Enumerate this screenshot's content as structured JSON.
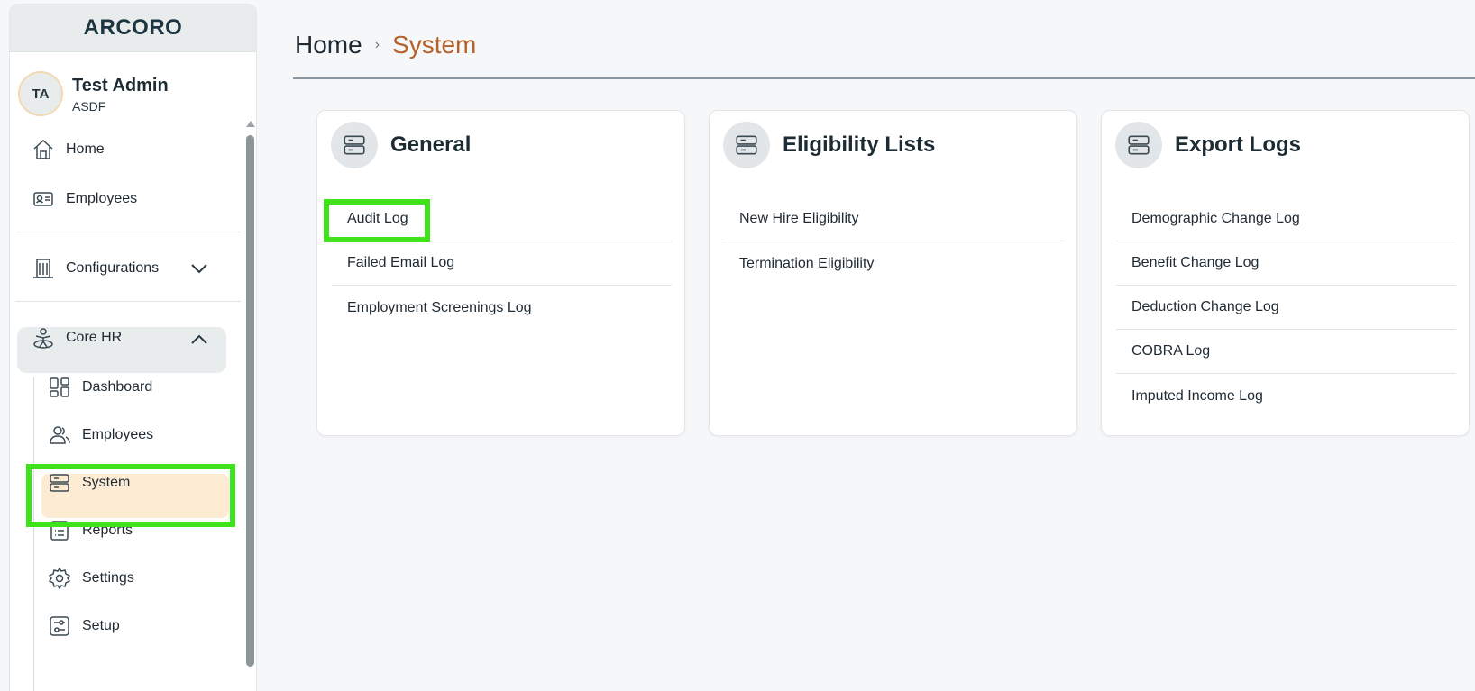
{
  "brand": {
    "logo_text": "ARCORO"
  },
  "user": {
    "initials": "TA",
    "name": "Test Admin",
    "org": "ASDF"
  },
  "sidebar": {
    "items": [
      {
        "label": "Home",
        "icon": "house-icon"
      },
      {
        "label": "Employees",
        "icon": "id-card-icon"
      },
      {
        "label": "Configurations",
        "icon": "building-icon",
        "expanded": false
      },
      {
        "label": "Core HR",
        "icon": "person-circle-icon",
        "expanded": true
      }
    ],
    "core_hr_items": [
      {
        "label": "Dashboard",
        "icon": "grid-icon"
      },
      {
        "label": "Employees",
        "icon": "users-icon"
      },
      {
        "label": "System",
        "icon": "server-icon",
        "active": true
      },
      {
        "label": "Reports",
        "icon": "list-icon"
      },
      {
        "label": "Settings",
        "icon": "gear-icon"
      },
      {
        "label": "Setup",
        "icon": "sliders-icon"
      }
    ]
  },
  "breadcrumb": {
    "home": "Home",
    "separator": "›",
    "current": "System"
  },
  "cards": [
    {
      "title": "General",
      "items": [
        "Audit Log",
        "Failed Email Log",
        "Employment Screenings Log"
      ]
    },
    {
      "title": "Eligibility Lists",
      "items": [
        "New Hire Eligibility",
        "Termination Eligibility"
      ]
    },
    {
      "title": "Export Logs",
      "items": [
        "Demographic Change Log",
        "Benefit Change Log",
        "Deduction Change Log",
        "COBRA Log",
        "Imputed Income Log"
      ]
    }
  ],
  "colors": {
    "accent": "#b5622a",
    "active_bg": "#fdebd4",
    "highlight": "#3fe31a"
  }
}
